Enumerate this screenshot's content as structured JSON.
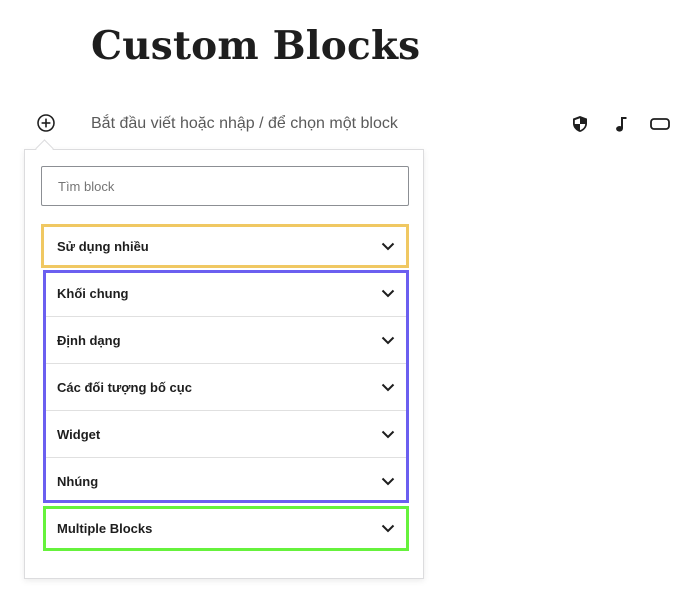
{
  "page": {
    "title": "Custom Blocks"
  },
  "editor": {
    "placeholder": "Bắt đầu viết hoặc nhập / để chọn một block",
    "add_block_icon": "plus-circle-icon",
    "quick_inserts": [
      {
        "icon": "shield-icon"
      },
      {
        "icon": "music-note-icon"
      },
      {
        "icon": "button-icon"
      }
    ]
  },
  "inserter": {
    "search_placeholder": "Tìm block",
    "panels": [
      {
        "label": "Sử dụng nhiều"
      },
      {
        "label": "Khối chung"
      },
      {
        "label": "Định dạng"
      },
      {
        "label": "Các đối tượng bố cục"
      },
      {
        "label": "Widget"
      },
      {
        "label": "Nhúng"
      },
      {
        "label": "Multiple Blocks"
      }
    ],
    "highlight_colors": {
      "group_1": "#f0c862",
      "group_2": "#6b5ff0",
      "group_3": "#66f23c"
    }
  }
}
